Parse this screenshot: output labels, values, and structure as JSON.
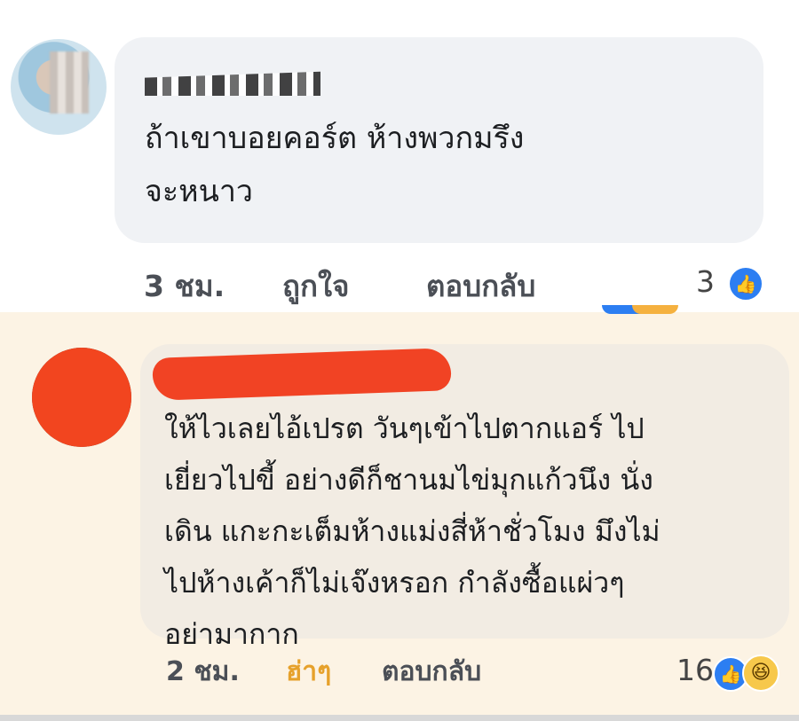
{
  "comments": [
    {
      "name": "",
      "text": "ถ้าเขาบอยคอร์ต ห้างพวกมรึง\nจะหนาว",
      "time": "3 ชม.",
      "action_primary": "ถูกใจ",
      "reply": "ตอบกลับ",
      "reaction_count": "3",
      "reaction_icons": [
        "like-icon"
      ]
    },
    {
      "name": "",
      "text": "ให้ไวเลยไอ้เปรต วันๆเข้าไปตากแอร์ ไป\nเยี่ยวไปขี้ อย่างดีก็ชานมไข่มุกแก้วนึง นั่ง\nเดิน แกะกะเต็มห้างแม่งสี่ห้าชั่วโมง มึงไม่\nไปห้างเค้าก็ไม่เจ๊งหรอก กำลังซื้อแผ่วๆ\nอย่ามากาก",
      "time": "2 ชม.",
      "action_primary": "ฮ่าๆ",
      "reply": "ตอบกลับ",
      "reaction_count": "16",
      "reaction_icons": [
        "like-icon",
        "haha-icon"
      ],
      "highlighted": true
    }
  ],
  "colors": {
    "bubble": "#f0f2f5",
    "highlight": "#fcf3e4",
    "like_blue": "#2c7ef2",
    "haha_gold": "#e6a12b",
    "redaction": "#f14324"
  }
}
